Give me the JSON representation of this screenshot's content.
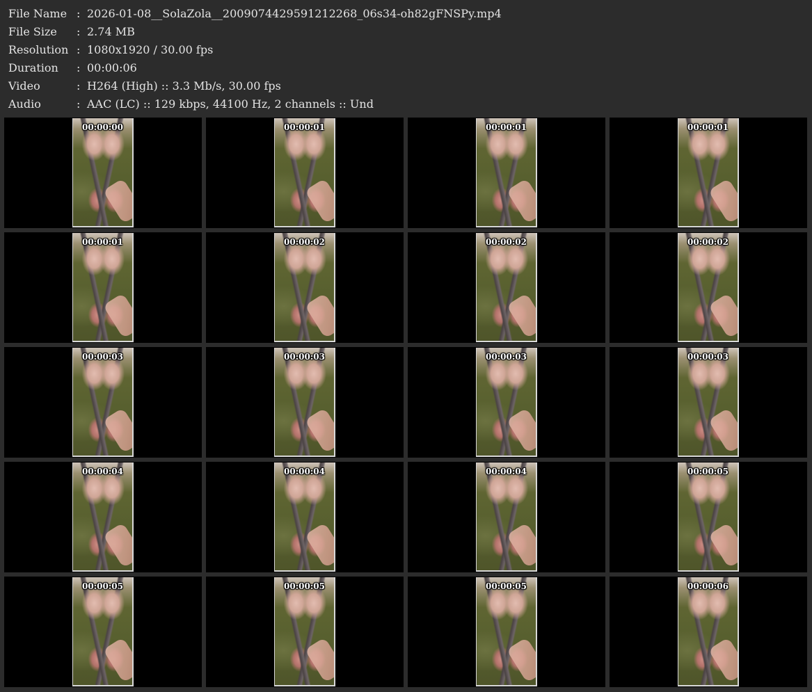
{
  "info": [
    {
      "label": "File Name",
      "sep": ":",
      "value": "2026-01-08__SolaZola__2009074429591212268_06s34-oh82gFNSPy.mp4"
    },
    {
      "label": "File Size",
      "sep": ":",
      "value": "2.74 MB"
    },
    {
      "label": "Resolution",
      "sep": ":",
      "value": "1080x1920 / 30.00 fps"
    },
    {
      "label": "Duration",
      "sep": ":",
      "value": "00:00:06"
    },
    {
      "label": "Video",
      "sep": ":",
      "value": "H264 (High) :: 3.3 Mb/s, 30.00 fps"
    },
    {
      "label": "Audio",
      "sep": ":",
      "value": "AAC (LC) :: 129 kbps, 44100 Hz, 2 channels :: Und"
    }
  ],
  "thumbnails": [
    "00:00:00",
    "00:00:01",
    "00:00:01",
    "00:00:01",
    "00:00:01",
    "00:00:02",
    "00:00:02",
    "00:00:02",
    "00:00:03",
    "00:00:03",
    "00:00:03",
    "00:00:03",
    "00:00:04",
    "00:00:04",
    "00:00:04",
    "00:00:05",
    "00:00:05",
    "00:00:05",
    "00:00:05",
    "00:00:06"
  ]
}
